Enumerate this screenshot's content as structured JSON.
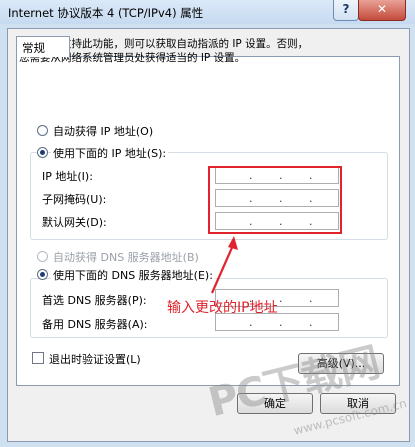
{
  "window": {
    "title": "Internet 协议版本 4 (TCP/IPv4) 属性",
    "help_label": "?",
    "close_label": "✕"
  },
  "tab": {
    "label": "常规"
  },
  "description": {
    "line1": "如果网络支持此功能，则可以获取自动指派的 IP 设置。否则，",
    "line2": "您需要从网络系统管理员处获得适当的 IP 设置。"
  },
  "ip_section": {
    "auto_option": "自动获得 IP 地址(O)",
    "manual_option": "使用下面的 IP 地址(S):",
    "selected": "manual",
    "fields": [
      {
        "label": "IP 地址(I):",
        "value": ". . ."
      },
      {
        "label": "子网掩码(U):",
        "value": ". . ."
      },
      {
        "label": "默认网关(D):",
        "value": ". . ."
      }
    ]
  },
  "dns_section": {
    "auto_option": "自动获得 DNS 服务器地址(B)",
    "manual_option": "使用下面的 DNS 服务器地址(E):",
    "selected": "manual",
    "fields": [
      {
        "label": "首选 DNS 服务器(P):",
        "value": ". . ."
      },
      {
        "label": "备用 DNS 服务器(A):",
        "value": ". . ."
      }
    ]
  },
  "validate_checkbox": {
    "label": "退出时验证设置(L)",
    "checked": false
  },
  "buttons": {
    "advanced": "高级(V)...",
    "ok": "确定",
    "cancel": "取消"
  },
  "annotation": {
    "text": "输入更改的IP地址",
    "color": "#e0232c"
  },
  "watermark": {
    "text": "PC下载网",
    "url": "www.pcsoft.com.cn"
  }
}
